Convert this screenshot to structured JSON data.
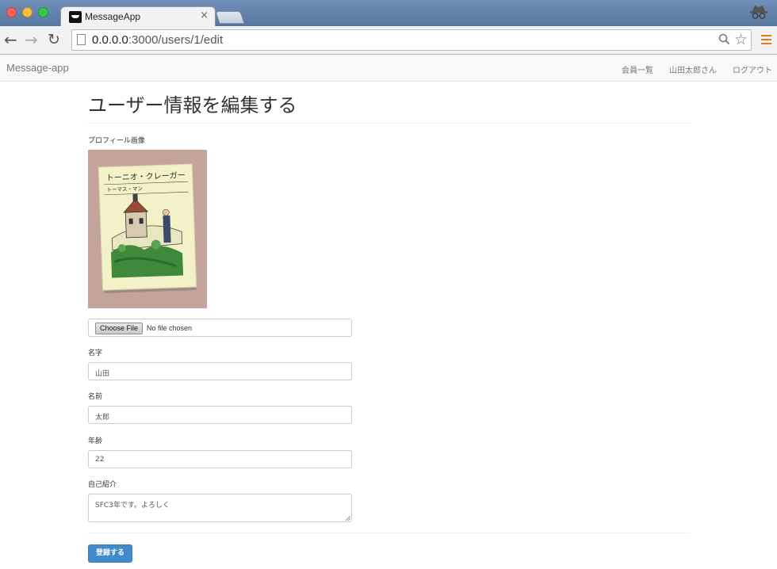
{
  "browser": {
    "tab_title": "MessageApp",
    "tab_close": "×",
    "url_host": "0.0.0.0",
    "url_path": ":3000/users/1/edit",
    "nav_back": "←",
    "nav_forward": "→",
    "nav_reload": "↻",
    "star": "☆"
  },
  "navbar": {
    "brand": "Message-app",
    "links": [
      "会員一覧",
      "山田太郎さん",
      "ログアウト"
    ]
  },
  "page": {
    "title": "ユーザー情報を編集する"
  },
  "form": {
    "profile_image_label": "プロフィール画像",
    "book_title": "トーニオ・クレーガー",
    "book_author": "トーマス・マン",
    "file_button": "Choose File",
    "file_status": "No file chosen",
    "last_name_label": "名字",
    "last_name_value": "山田",
    "first_name_label": "名前",
    "first_name_value": "太郎",
    "age_label": "年齢",
    "age_value": "22",
    "bio_label": "自己紹介",
    "bio_value": "SFC3年です。よろしく",
    "submit_label": "登録する"
  },
  "colors": {
    "primary": "#428bca",
    "chrome_frame": "#5f80a9",
    "menu_accent": "#e07a1f"
  }
}
